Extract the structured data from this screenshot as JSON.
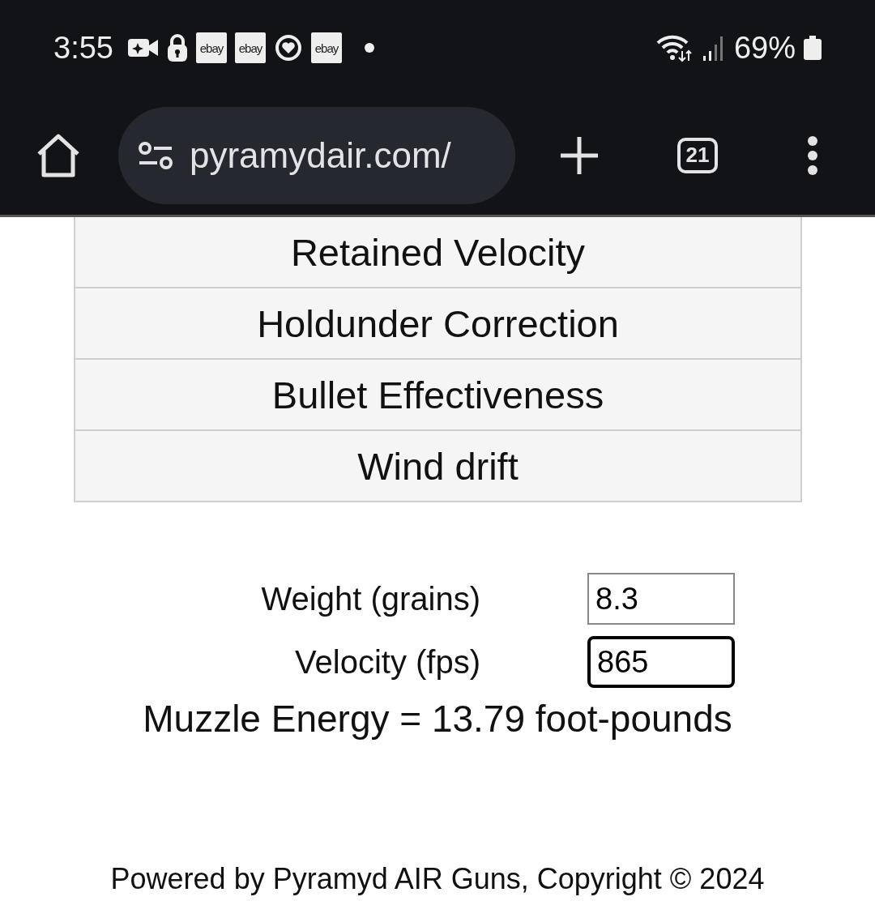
{
  "status_bar": {
    "time": "3:55",
    "notifications": [
      {
        "kind": "video"
      },
      {
        "kind": "lock"
      },
      {
        "kind": "app",
        "label": "ebay"
      },
      {
        "kind": "app",
        "label": "ebay"
      },
      {
        "kind": "ring"
      },
      {
        "kind": "app",
        "label": "ebay"
      },
      {
        "kind": "dot"
      }
    ],
    "battery_text": "69%"
  },
  "browser": {
    "url": "pyramydair.com/",
    "tab_count": "21"
  },
  "menu": [
    {
      "label": "Retained Velocity"
    },
    {
      "label": "Holdunder Correction"
    },
    {
      "label": "Bullet Effectiveness"
    },
    {
      "label": "Wind drift"
    }
  ],
  "form": {
    "fields": [
      {
        "label": "Weight (grains)",
        "value": "8.3",
        "focused": false
      },
      {
        "label": "Velocity (fps)",
        "value": "865",
        "focused": true
      }
    ],
    "result": "Muzzle Energy = 13.79 foot-pounds"
  },
  "footer": "Powered by Pyramyd AIR Guns, Copyright © 2024"
}
